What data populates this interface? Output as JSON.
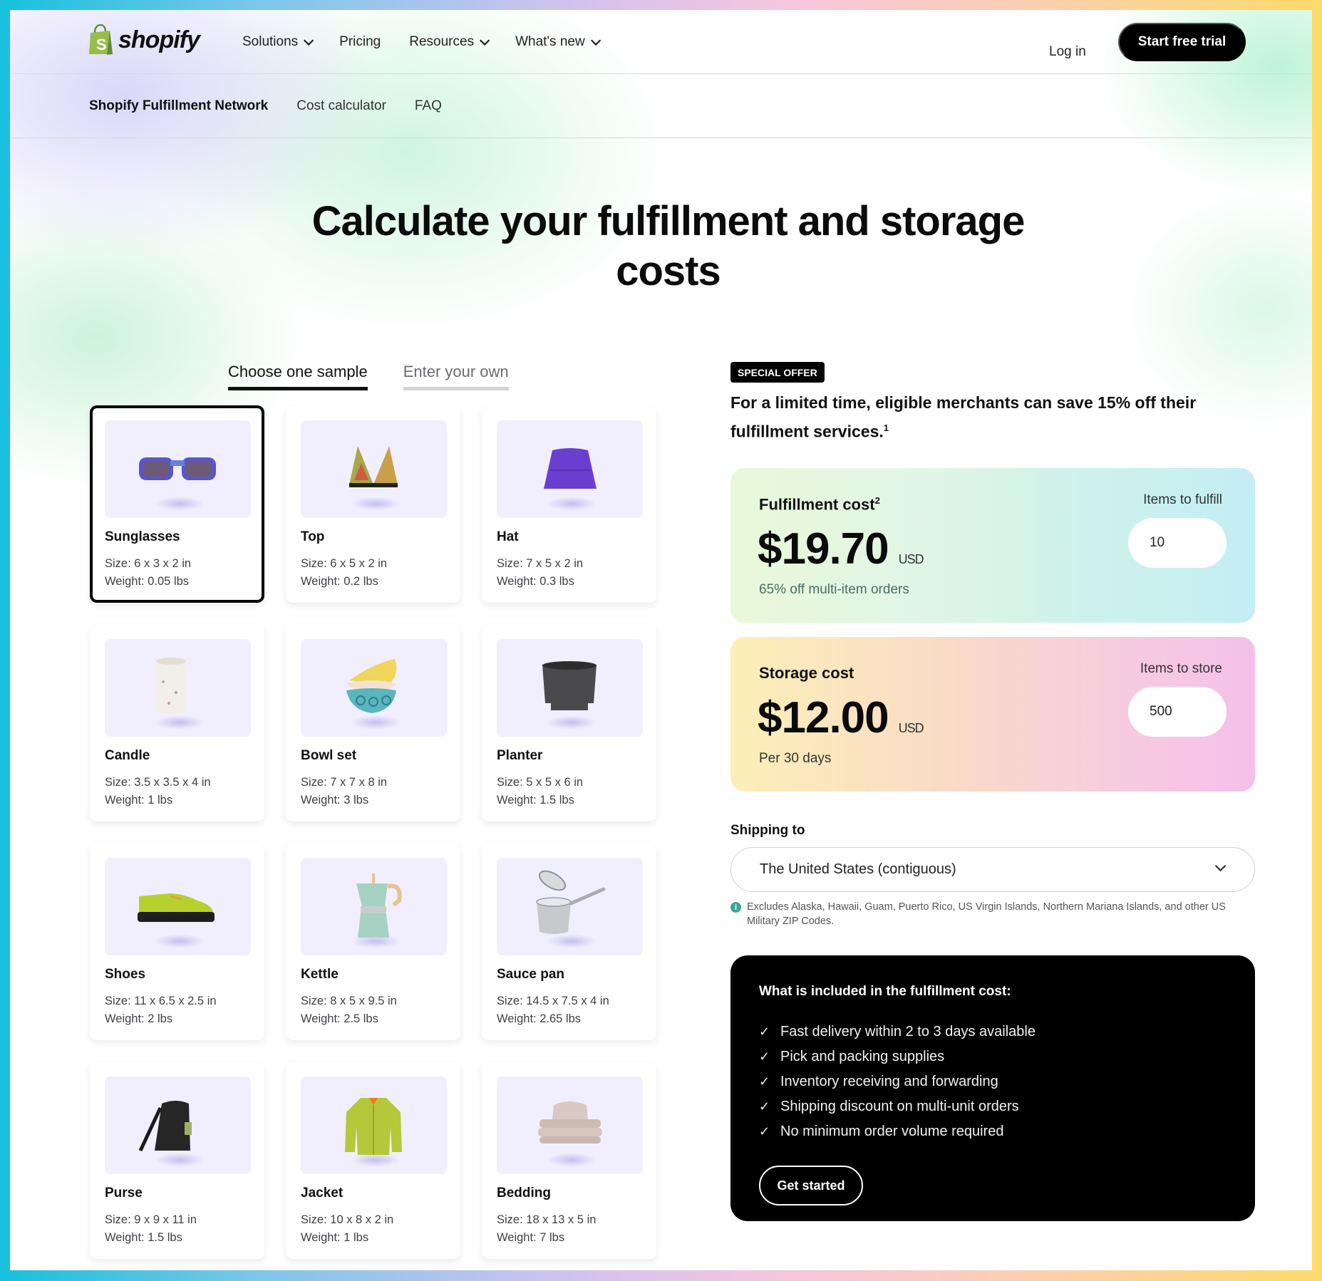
{
  "nav": {
    "logo_text": "shopify",
    "links": [
      {
        "label": "Solutions",
        "has_dropdown": true
      },
      {
        "label": "Pricing",
        "has_dropdown": false
      },
      {
        "label": "Resources",
        "has_dropdown": true
      },
      {
        "label": "What's new",
        "has_dropdown": true
      }
    ],
    "login_label": "Log in",
    "cta_label": "Start free trial"
  },
  "subnav": {
    "items": [
      {
        "label": "Shopify Fulfillment Network",
        "active": true
      },
      {
        "label": "Cost calculator",
        "active": false
      },
      {
        "label": "FAQ",
        "active": false
      }
    ]
  },
  "hero": {
    "title_line1": "Calculate your fulfillment and storage",
    "title_line2": "costs"
  },
  "tabs": [
    {
      "label": "Choose one sample",
      "active": true
    },
    {
      "label": "Enter your own",
      "active": false
    }
  ],
  "samples": [
    {
      "name": "Sunglasses",
      "size": "Size: 6 x 3 x 2 in",
      "weight": "Weight: 0.05 lbs",
      "icon": "sunglasses-icon",
      "selected": true
    },
    {
      "name": "Top",
      "size": "Size: 6 x 5 x 2 in",
      "weight": "Weight: 0.2 lbs",
      "icon": "bikini-top-icon",
      "selected": false
    },
    {
      "name": "Hat",
      "size": "Size: 7 x 5 x 2 in",
      "weight": "Weight: 0.3 lbs",
      "icon": "bucket-hat-icon",
      "selected": false
    },
    {
      "name": "Candle",
      "size": "Size: 3.5 x 3.5 x 4 in",
      "weight": "Weight: 1 lbs",
      "icon": "candle-icon",
      "selected": false
    },
    {
      "name": "Bowl set",
      "size": "Size: 7 x 7 x 8 in",
      "weight": "Weight: 3 lbs",
      "icon": "bowl-set-icon",
      "selected": false
    },
    {
      "name": "Planter",
      "size": "Size: 5 x 5 x 6 in",
      "weight": "Weight: 1.5 lbs",
      "icon": "planter-icon",
      "selected": false
    },
    {
      "name": "Shoes",
      "size": "Size: 11 x 6.5 x 2.5 in",
      "weight": "Weight: 2 lbs",
      "icon": "shoe-icon",
      "selected": false
    },
    {
      "name": "Kettle",
      "size": "Size: 8 x 5 x 9.5 in",
      "weight": "Weight: 2.5 lbs",
      "icon": "kettle-icon",
      "selected": false
    },
    {
      "name": "Sauce pan",
      "size": "Size: 14.5 x 7.5 x 4 in",
      "weight": "Weight: 2.65 lbs",
      "icon": "sauce-pan-icon",
      "selected": false
    },
    {
      "name": "Purse",
      "size": "Size: 9 x 9 x 11 in",
      "weight": "Weight: 1.5 lbs",
      "icon": "purse-icon",
      "selected": false
    },
    {
      "name": "Jacket",
      "size": "Size: 10 x 8 x 2 in",
      "weight": "Weight: 1 lbs",
      "icon": "jacket-icon",
      "selected": false
    },
    {
      "name": "Bedding",
      "size": "Size: 18 x 13 x 5 in",
      "weight": "Weight: 7 lbs",
      "icon": "bedding-icon",
      "selected": false
    }
  ],
  "offer": {
    "badge": "SPECIAL OFFER",
    "text": "For a limited time, eligible merchants can save 15% off their fulfillment services.",
    "footnote": "1"
  },
  "fulfillment": {
    "label": "Fulfillment cost",
    "footnote": "2",
    "value": "$19.70",
    "currency": "USD",
    "note": "65% off multi-item orders",
    "qty_label": "Items to fulfill",
    "qty_value": "10"
  },
  "storage": {
    "label": "Storage cost",
    "value": "$12.00",
    "currency": "USD",
    "note": "Per 30 days",
    "qty_label": "Items to store",
    "qty_value": "500"
  },
  "shipping": {
    "label": "Shipping to",
    "selected": "The United States (contiguous)",
    "note": "Excludes Alaska, Hawaii, Guam, Puerto Rico, US Virgin Islands, Northern Mariana Islands, and other US Military ZIP Codes."
  },
  "included": {
    "title": "What is included in the fulfillment cost:",
    "items": [
      "Fast delivery within 2 to 3 days available",
      "Pick and packing supplies",
      "Inventory receiving and forwarding",
      "Shipping discount on multi-unit orders",
      "No minimum order volume required"
    ],
    "button_label": "Get started"
  },
  "colors": {
    "brand_green": "#95bf47",
    "primary_black": "#000000",
    "info_teal": "#3fa596"
  }
}
